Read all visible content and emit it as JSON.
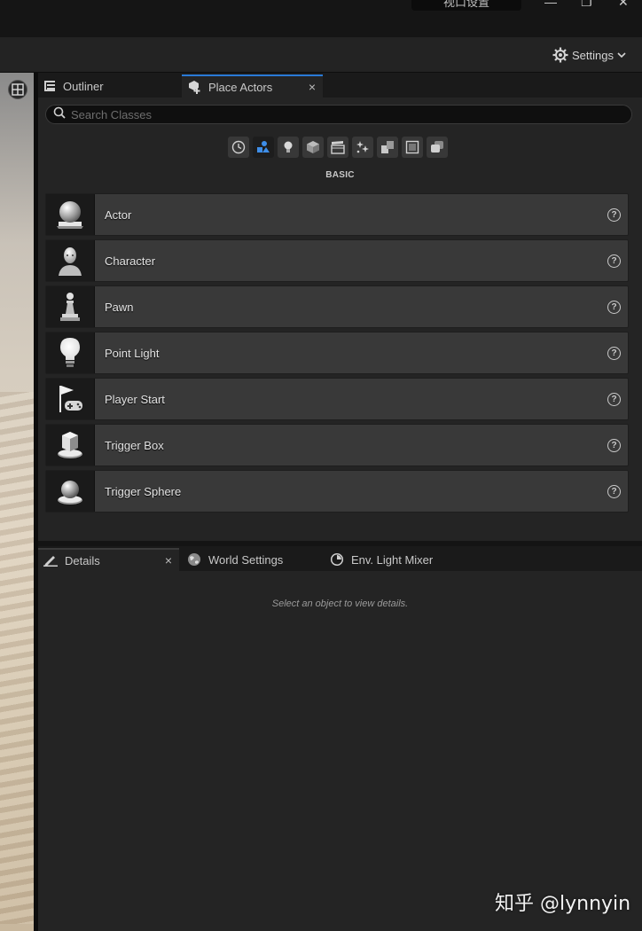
{
  "titlebar": {
    "pill_text": "视口设置",
    "minimize": "—",
    "maximize": "❐",
    "close": "✕"
  },
  "settings": {
    "label": "Settings",
    "icon": "gear-icon"
  },
  "viewport": {
    "layout_icon": "viewport-layout-icon"
  },
  "top_tabs": [
    {
      "label": "Outliner",
      "icon": "outliner-icon"
    },
    {
      "label": "Place Actors",
      "icon": "place-actors-icon",
      "close": "×"
    }
  ],
  "search": {
    "placeholder": "Search Classes"
  },
  "categories": [
    {
      "icon": "recent-clock-icon"
    },
    {
      "icon": "basic-shapes-icon",
      "active": true
    },
    {
      "icon": "lights-icon"
    },
    {
      "icon": "cube-icon"
    },
    {
      "icon": "cinematic-clapper-icon"
    },
    {
      "icon": "visual-effects-icon"
    },
    {
      "icon": "geometry-icon"
    },
    {
      "icon": "volumes-icon"
    },
    {
      "icon": "all-classes-icon"
    }
  ],
  "section_label": "BASIC",
  "actors": [
    {
      "label": "Actor",
      "icon": "actor-sphere-icon"
    },
    {
      "label": "Character",
      "icon": "character-icon"
    },
    {
      "label": "Pawn",
      "icon": "pawn-icon"
    },
    {
      "label": "Point Light",
      "icon": "lightbulb-icon"
    },
    {
      "label": "Player Start",
      "icon": "player-start-flag-icon"
    },
    {
      "label": "Trigger Box",
      "icon": "trigger-box-icon"
    },
    {
      "label": "Trigger Sphere",
      "icon": "trigger-sphere-icon"
    }
  ],
  "help_glyph": "?",
  "bottom_tabs": [
    {
      "label": "Details",
      "icon": "details-pencil-icon",
      "close": "×"
    },
    {
      "label": "World Settings",
      "icon": "globe-icon"
    },
    {
      "label": "Env. Light Mixer",
      "icon": "light-mixer-icon"
    }
  ],
  "details_message": "Select an object to view details.",
  "watermark": "知乎 @lynnyin",
  "colors": {
    "accent": "#2a7ad6",
    "panel": "#242424",
    "row": "#393939"
  }
}
